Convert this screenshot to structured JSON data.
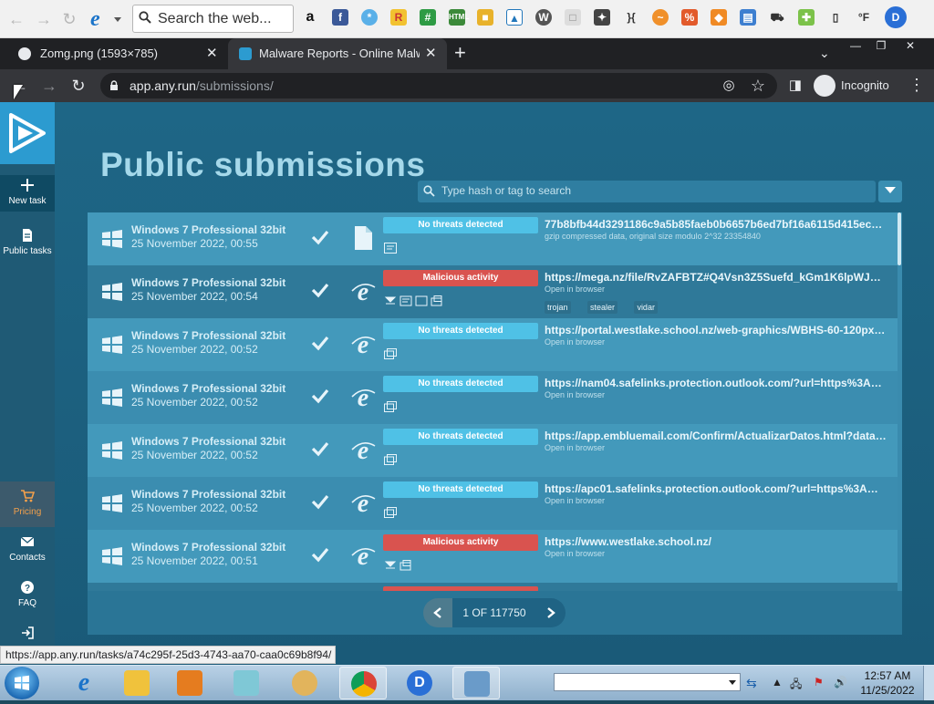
{
  "browser": {
    "search_web_placeholder": "Search the web...",
    "tabs": [
      {
        "label": "Zomg.png (1593×785)",
        "active": false
      },
      {
        "label": "Malware Reports - Online Malwa",
        "active": true
      }
    ],
    "address": {
      "domain": "app.any.run",
      "path": "/submissions/"
    },
    "incognito_label": "Incognito",
    "status_url": "https://app.any.run/tasks/a74c295f-25d3-4743-aa70-caa0c69b8f94/"
  },
  "sidebar": {
    "new_task": "New task",
    "public_tasks": "Public tasks",
    "pricing": "Pricing",
    "contacts": "Contacts",
    "faq": "FAQ"
  },
  "page": {
    "title": "Public submissions",
    "search_placeholder": "Type hash or tag to search"
  },
  "rows": [
    {
      "os": "Windows 7 Professional 32bit",
      "date": "25 November 2022, 00:55",
      "verdict": "No threats detected",
      "link": "77b8bfb44d3291186c9a5b85faeb0b6657b6ed7bf16a6115d415ecb...",
      "sub": "gzip compressed data, original size modulo 2^32 23354840",
      "tags": []
    },
    {
      "os": "Windows 7 Professional 32bit",
      "date": "25 November 2022, 00:54",
      "verdict": "Malicious activity",
      "link": "https://mega.nz/file/RvZAFBTZ#Q4Vsn3Z5Suefd_kGm1K6lpWJ1W...",
      "sub": "Open in browser",
      "tags": [
        "trojan",
        "stealer",
        "vidar"
      ]
    },
    {
      "os": "Windows 7 Professional 32bit",
      "date": "25 November 2022, 00:52",
      "verdict": "No threats detected",
      "link": "https://portal.westlake.school.nz/web-graphics/WBHS-60-120px.png",
      "sub": "Open in browser",
      "tags": []
    },
    {
      "os": "Windows 7 Professional 32bit",
      "date": "25 November 2022, 00:52",
      "verdict": "No threats detected",
      "link": "https://nam04.safelinks.protection.outlook.com/?url=https%3A%2F...",
      "sub": "Open in browser",
      "tags": []
    },
    {
      "os": "Windows 7 Professional 32bit",
      "date": "25 November 2022, 00:52",
      "verdict": "No threats detected",
      "link": "https://app.embluemail.com/Confirm/ActualizarDatos.html?data=fK...",
      "sub": "Open in browser",
      "tags": []
    },
    {
      "os": "Windows 7 Professional 32bit",
      "date": "25 November 2022, 00:52",
      "verdict": "No threats detected",
      "link": "https://apc01.safelinks.protection.outlook.com/?url=https%3A%2F...",
      "sub": "Open in browser",
      "tags": []
    },
    {
      "os": "Windows 7 Professional 32bit",
      "date": "25 November 2022, 00:51",
      "verdict": "Malicious activity",
      "link": "https://www.westlake.school.nz/",
      "sub": "Open in browser",
      "tags": []
    }
  ],
  "pager": {
    "label": "1 OF 117750"
  },
  "taskbar": {
    "clock_time": "12:57 AM",
    "clock_date": "11/25/2022"
  },
  "colors": {
    "accent": "#2c9bd0",
    "no_threat": "#4fc1e6",
    "malicious": "#d9534f",
    "title": "#a5d8ea"
  }
}
